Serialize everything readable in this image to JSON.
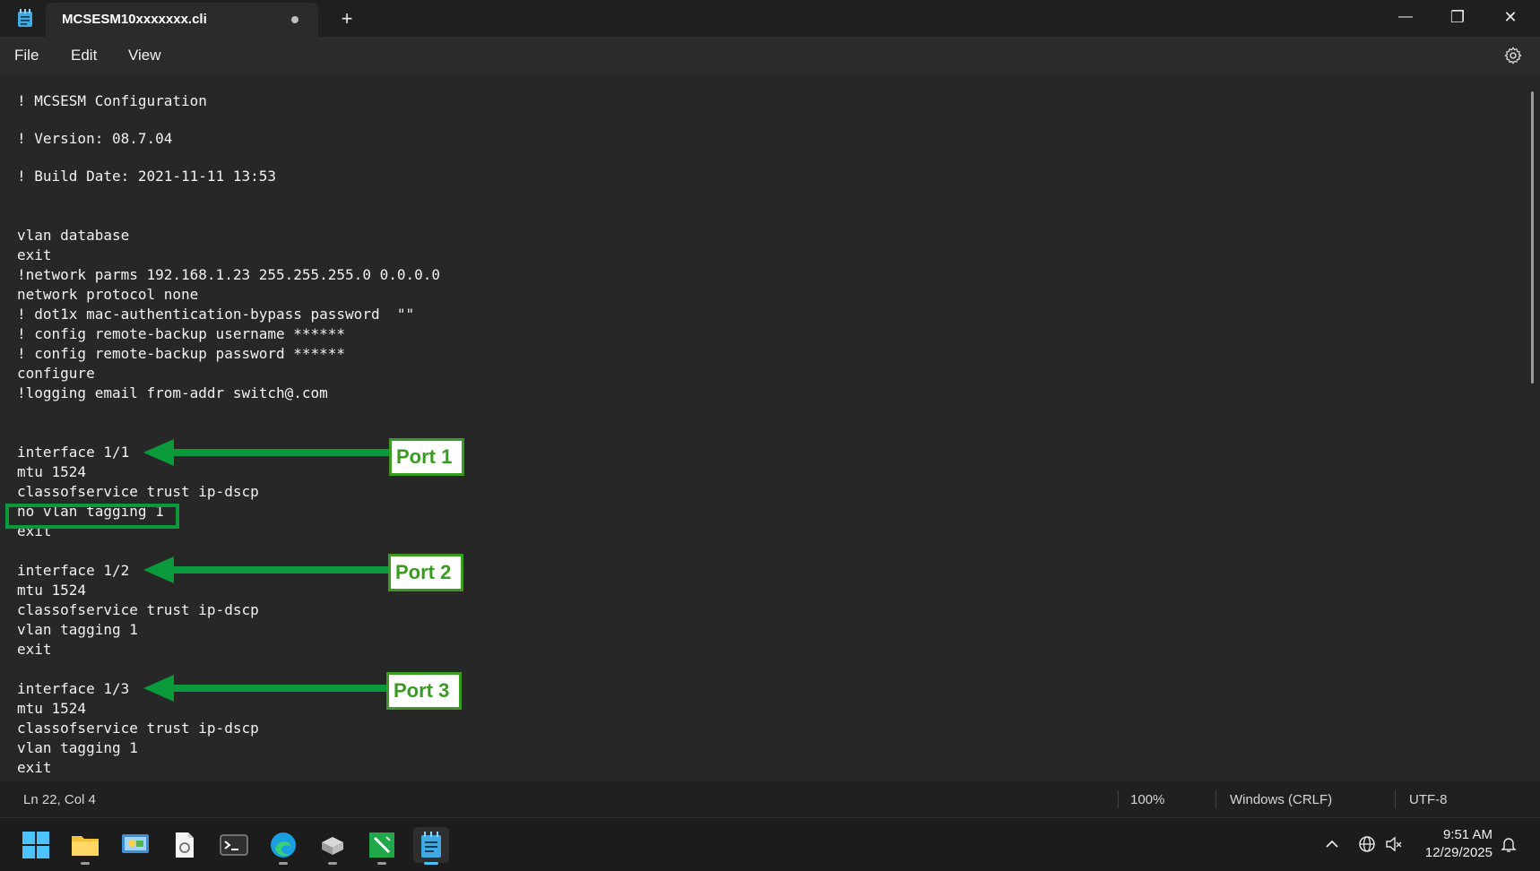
{
  "window": {
    "tab_title": "MCSESM10xxxxxxx.cli",
    "new_tab_label": "+",
    "minimize_label": "—",
    "restore_label": "❐",
    "close_label": "✕"
  },
  "menu": {
    "file": "File",
    "edit": "Edit",
    "view": "View"
  },
  "editor": {
    "lines": [
      "! MCSESM Configuration",
      "! Version: 08.7.04",
      "! Build Date: 2021-11-11 13:53",
      "vlan database",
      "exit",
      "!network parms 192.168.1.23 255.255.255.0 0.0.0.0",
      "network protocol none",
      "! dot1x mac-authentication-bypass password  \"\"",
      "! config remote-backup username ******",
      "! config remote-backup password ******",
      "configure",
      "!logging email from-addr switch@.com",
      "interface 1/1",
      "mtu 1524",
      "classofservice trust ip-dscp",
      "no vlan tagging 1",
      "exit",
      "interface 1/2",
      "mtu 1524",
      "classofservice trust ip-dscp",
      "vlan tagging 1",
      "exit",
      "interface 1/3",
      "mtu 1524",
      "classofservice trust ip-dscp",
      "vlan tagging 1",
      "exit"
    ]
  },
  "annotations": {
    "port1": "Port 1",
    "port2": "Port 2",
    "port3": "Port 3",
    "color": "#0b9a3b",
    "label_color": "#3a9a22"
  },
  "status": {
    "position": "Ln 22, Col 4",
    "zoom": "100%",
    "line_endings": "Windows (CRLF)",
    "encoding": "UTF-8"
  },
  "taskbar": {
    "apps": [
      "start-icon",
      "file-explorer-icon",
      "control-panel-icon",
      "document-settings-icon",
      "terminal-icon",
      "edge-icon",
      "network-tool-icon",
      "edit-tool-icon",
      "notepad-icon"
    ],
    "time": "9:51 AM",
    "date": "12/29/2025"
  }
}
